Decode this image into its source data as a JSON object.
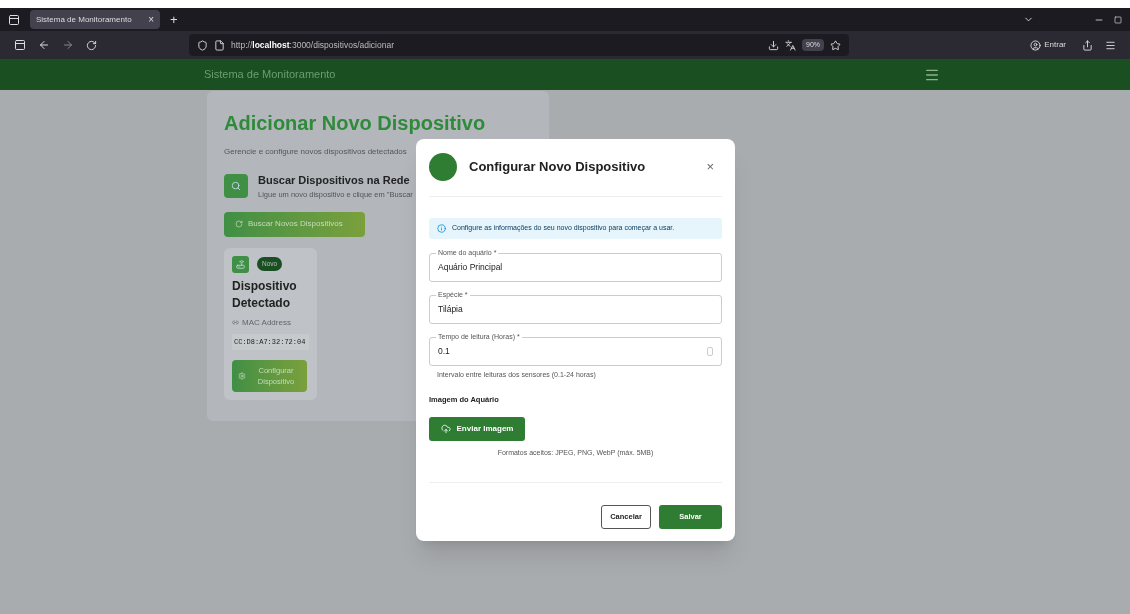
{
  "browser": {
    "tab": {
      "title": "Sistema de Monitoramento",
      "close": "×",
      "selected": true
    },
    "new_tab": "+",
    "url": "http://**localhost**:3000/dispositivos/adicionar",
    "zoom": "90%",
    "account": "Entrar"
  },
  "app_bar": {
    "title": "Sistema de Monitoramento"
  },
  "page": {
    "title": "Adicionar Novo Dispositivo",
    "subtitle": "Gerencie e configure novos dispositivos detectados",
    "search_section": {
      "title": "Buscar Dispositivos na Rede",
      "description": "Ligue um novo dispositivo e clique em \"Buscar"
    },
    "search_button": "Buscar Novos Dispositivos",
    "devices": [
      {
        "badge": "Novo",
        "name": "Dispositivo Detectado",
        "mac_label": "MAC Address",
        "mac": "CC:D8:A7:32:72:04",
        "button": "Configurar Dispositivo"
      }
    ]
  },
  "dialog": {
    "title": "Configurar Novo Dispositivo",
    "close": "×",
    "info": "Configure as informações do seu novo dispositivo para começar a usar.",
    "fields": [
      {
        "kind": "text",
        "label": "Nome do aquário *",
        "value": "Aquário Principal"
      },
      {
        "kind": "text",
        "label": "Espécie *",
        "value": "Tilápia"
      },
      {
        "kind": "number",
        "label": "Tempo de leitura (Horas) *",
        "value": "0.1",
        "helper": "Intervalo entre leituras dos sensores (0.1-24 horas)"
      }
    ],
    "image_section": {
      "title": "Imagem do Aquário",
      "button": "Enviar Imagem",
      "hint": "Formatos aceitos: JPEG, PNG, WebP (máx. 5MB)"
    },
    "buttons": [
      {
        "kind": "outline",
        "label": "Cancelar"
      },
      {
        "kind": "primary",
        "label": "Salvar"
      }
    ]
  }
}
